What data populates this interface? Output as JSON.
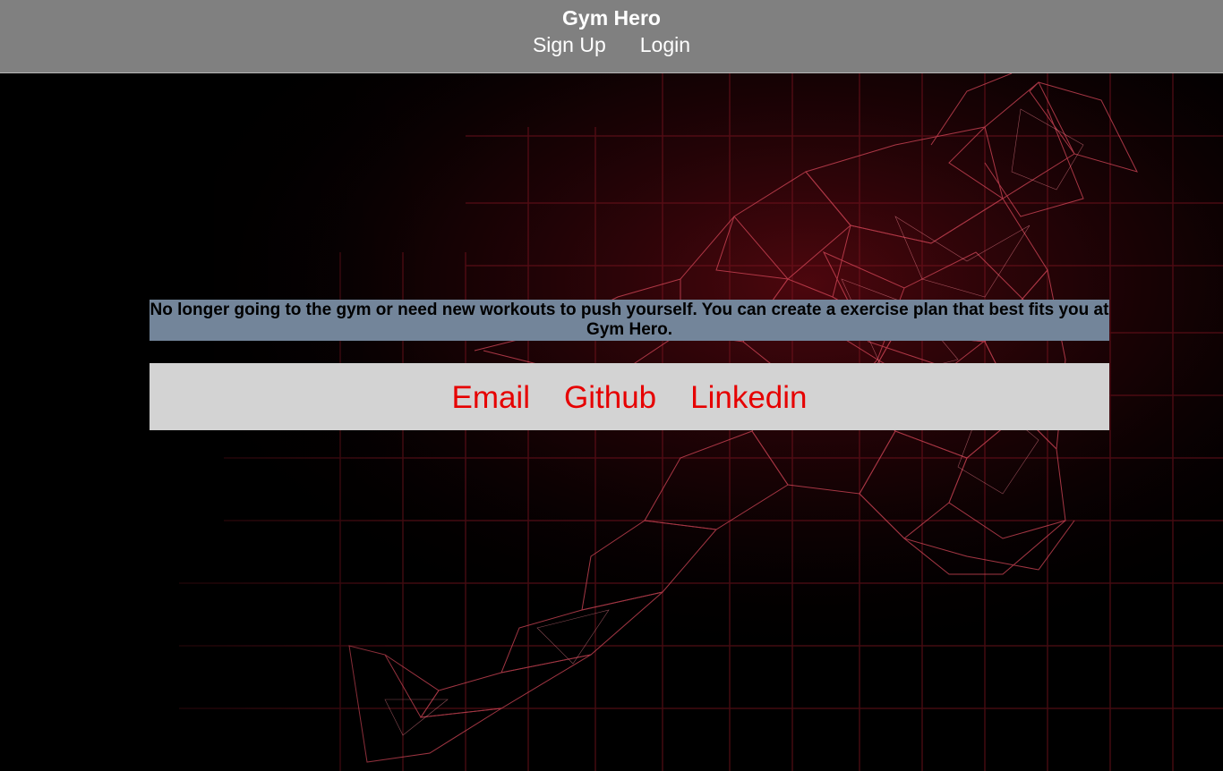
{
  "header": {
    "brand": "Gym Hero",
    "nav": [
      {
        "label": "Sign Up"
      },
      {
        "label": "Login"
      }
    ]
  },
  "hero": {
    "tagline": "No longer going to the gym or need new workouts to push yourself. You can create a exercise plan that best fits you at Gym Hero."
  },
  "contact": {
    "links": [
      {
        "label": "Email"
      },
      {
        "label": "Github"
      },
      {
        "label": "Linkedin"
      }
    ],
    "link_color": "#e60000"
  },
  "colors": {
    "header_bg": "#808080",
    "tagline_bg": "#73859a",
    "contact_bg": "#d3d3d3",
    "page_bg": "#000000",
    "hero_accent": "#c0283a"
  },
  "background_image": "wireframe-runner-illustration"
}
